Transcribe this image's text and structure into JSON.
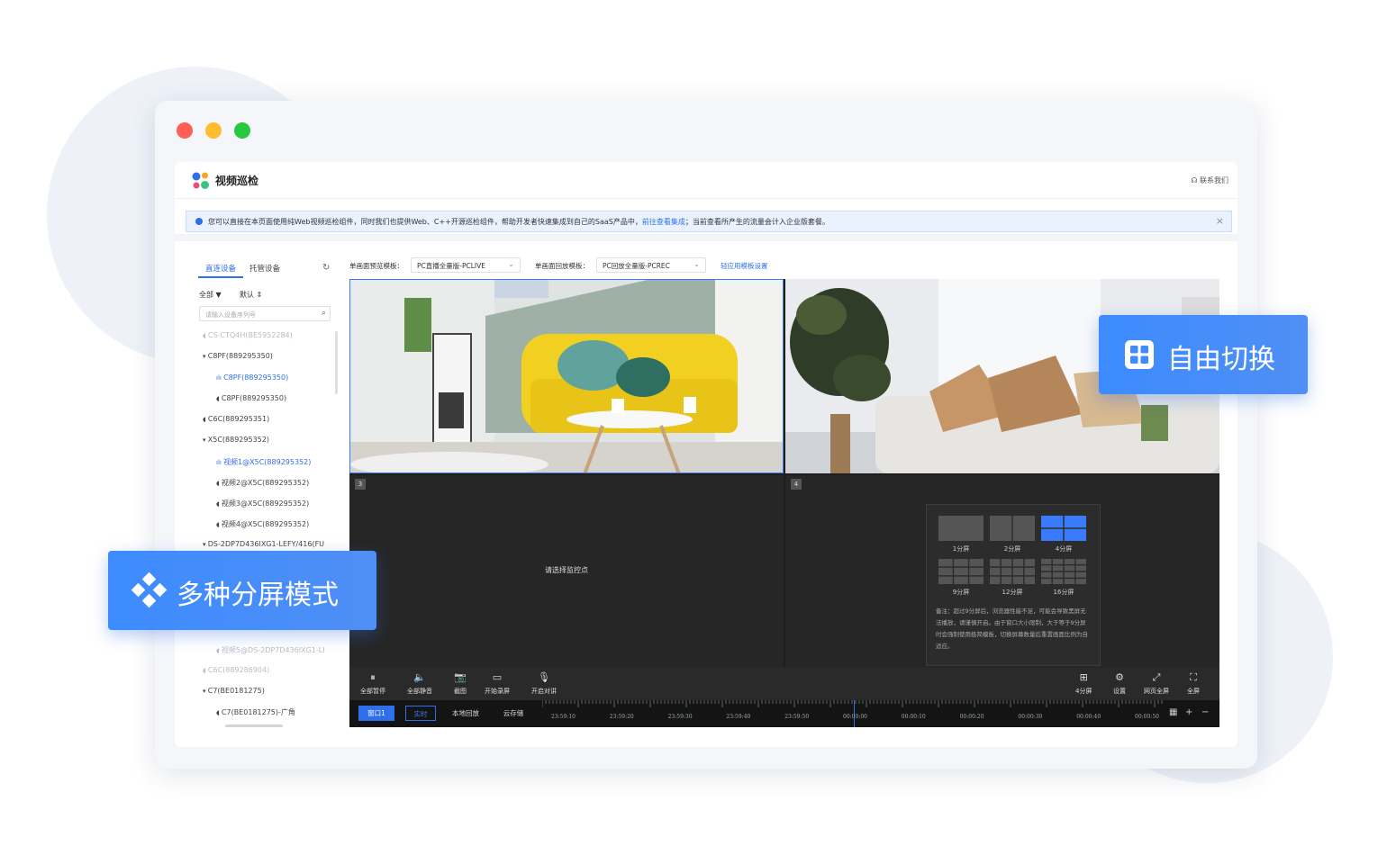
{
  "window": {
    "controls": {
      "close_color": "#ff5f57",
      "minimize_color": "#febc2e",
      "zoom_color": "#28c840"
    }
  },
  "header": {
    "app_title": "视频巡检",
    "contact_label": "联系我们",
    "contact_icon": "headset-icon",
    "logo_colors": [
      "#2f6fe9",
      "#f5a623",
      "#e94e77",
      "#3cc47c"
    ]
  },
  "notice": {
    "text_before": "您可以直接在本页面使用纯Web视频巡检组件，同时我们也提供Web、C++开源巡检组件，帮助开发者快速集成到自己的SaaS产品中，",
    "link": "前往查看集成",
    "text_after": "；当前查看所产生的流量会计入企业版套餐。",
    "close": "×"
  },
  "sidebar": {
    "tabs": [
      {
        "label": "直连设备",
        "active": true
      },
      {
        "label": "托管设备",
        "active": false
      }
    ],
    "refresh_icon": "↻",
    "filter_all": "全部",
    "filter_default": "默认",
    "search_placeholder": "请输入设备序列号",
    "tree": [
      {
        "label": "CS-CTQ4H(BE5952284)",
        "state": "dim",
        "indent": 0,
        "prefix": "cam"
      },
      {
        "label": "C8PF(889295350)",
        "state": "normal",
        "indent": 0,
        "prefix": "caret"
      },
      {
        "label": "C8PF(889295350)",
        "state": "selected",
        "indent": 1,
        "prefix": "live"
      },
      {
        "label": "C8PF(889295350)",
        "state": "normal",
        "indent": 1,
        "prefix": "cam"
      },
      {
        "label": "C6C(889295351)",
        "state": "normal",
        "indent": 0,
        "prefix": "cam"
      },
      {
        "label": "X5C(889295352)",
        "state": "normal",
        "indent": 0,
        "prefix": "caret"
      },
      {
        "label": "视频1@X5C(889295352)",
        "state": "selected",
        "indent": 1,
        "prefix": "live"
      },
      {
        "label": "视频2@X5C(889295352)",
        "state": "normal",
        "indent": 1,
        "prefix": "cam"
      },
      {
        "label": "视频3@X5C(889295352)",
        "state": "normal",
        "indent": 1,
        "prefix": "cam"
      },
      {
        "label": "视频4@X5C(889295352)",
        "state": "normal",
        "indent": 1,
        "prefix": "cam"
      },
      {
        "label": "DS-2DP7D436IXG1-LEFY/416(FU",
        "state": "normal",
        "indent": 0,
        "prefix": "caret"
      },
      {
        "label": "视频5@DS-2DP7D436IXG1-LI",
        "state": "dim",
        "indent": 1,
        "prefix": "cam"
      },
      {
        "label": "C6C(889286904)",
        "state": "dim",
        "indent": 0,
        "prefix": "cam"
      },
      {
        "label": "C7(BE0181275)",
        "state": "normal",
        "indent": 0,
        "prefix": "caret"
      },
      {
        "label": "C7(BE0181275)-广角",
        "state": "normal",
        "indent": 1,
        "prefix": "cam"
      }
    ]
  },
  "templates": {
    "preview_label": "单画面预览模板：",
    "preview_value": "PC直播全量版-PCLIVE",
    "playback_label": "单画面回放模板：",
    "playback_value": "PC回放全量版-PCREC",
    "apply_link": "轻应用模板设置"
  },
  "player": {
    "cells": [
      {
        "num": "",
        "scene": "yellow-sofa-living-room"
      },
      {
        "num": "",
        "scene": "plant-and-cushions"
      },
      {
        "num": "3",
        "text": "请选择监控点"
      },
      {
        "num": "4",
        "text": ""
      }
    ],
    "layout_panel": {
      "options": [
        {
          "label": "1分屏",
          "rows": 1,
          "cols": 1,
          "active": false
        },
        {
          "label": "2分屏",
          "rows": 1,
          "cols": 2,
          "active": false
        },
        {
          "label": "4分屏",
          "rows": 2,
          "cols": 2,
          "active": true
        },
        {
          "label": "9分屏",
          "rows": 3,
          "cols": 3,
          "active": false
        },
        {
          "label": "12分屏",
          "rows": 3,
          "cols": 4,
          "active": false
        },
        {
          "label": "16分屏",
          "rows": 4,
          "cols": 4,
          "active": false
        }
      ],
      "note": "备注：超过9分屏后，浏览器性能不足，可能会导致黑屏无法播放，请谨慎开启。由于窗口大小限制，大于等于9分屏时会强制使用极简模板，切换屏幕数量后重置画面比例为自适应。"
    },
    "toolbar_left": [
      {
        "label": "全部暂停",
        "icon": "pause-icon",
        "glyph": "⏸"
      },
      {
        "label": "全部静音",
        "icon": "speaker-icon",
        "glyph": "🔈"
      },
      {
        "label": "截图",
        "icon": "camera-icon",
        "glyph": "📷"
      },
      {
        "label": "开始录屏",
        "icon": "video-icon",
        "glyph": "▭"
      },
      {
        "label": "开启对讲",
        "icon": "mic-icon",
        "glyph": "🎙"
      }
    ],
    "toolbar_right": [
      {
        "label": "4分屏",
        "icon": "split-screen-icon",
        "glyph": "⊞"
      },
      {
        "label": "设置",
        "icon": "settings-icon",
        "glyph": "⚙"
      },
      {
        "label": "网页全屏",
        "icon": "expand-icon",
        "glyph": "⤢"
      },
      {
        "label": "全屏",
        "icon": "fullscreen-icon",
        "glyph": "⛶"
      }
    ],
    "timebar": {
      "window_btn": "窗口1",
      "mode_live": "实时",
      "mode_local": "本地回放",
      "mode_cloud": "云存储",
      "times": [
        "23:59:10",
        "23:59:20",
        "23:59:30",
        "23:59:40",
        "23:59:50",
        "00:00:00",
        "00:00:10",
        "00:00:20",
        "00:00:30",
        "00:00:40",
        "00:00:50"
      ],
      "ctrl_calendar": "▦",
      "ctrl_plus": "+",
      "ctrl_minus": "−"
    }
  },
  "badges": {
    "switch": {
      "label": "自由切换",
      "icon": "grid-icon"
    },
    "modes": {
      "label": "多种分屏模式",
      "icon": "diamond-grid-icon"
    }
  },
  "colors": {
    "accent": "#2f6fe9",
    "badge": "#3d8bff"
  }
}
